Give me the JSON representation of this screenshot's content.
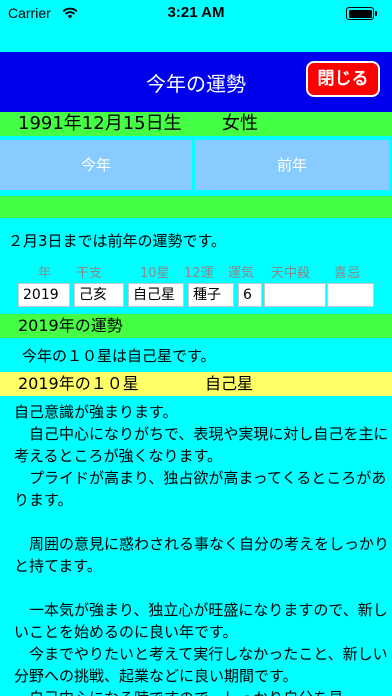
{
  "status_bar": {
    "carrier": "Carrier",
    "time": "3:21 AM"
  },
  "nav": {
    "title": "今年の運勢",
    "close_label": "閉じる"
  },
  "profile": {
    "birth_date": "1991年12月15日生",
    "gender": "女性"
  },
  "tabs": [
    {
      "label": "今年"
    },
    {
      "label": "前年"
    }
  ],
  "notice": "２月3日までは前年の運勢です。",
  "table": {
    "headers": [
      "年",
      "干支",
      "10星",
      "12運",
      "運気",
      "天中殺",
      "喜忌"
    ],
    "values": [
      "2019",
      "己亥",
      "自己星",
      "種子",
      "6",
      "",
      ""
    ]
  },
  "fortune_section": {
    "title": "2019年の運勢",
    "summary": "今年の１０星は自己星です。"
  },
  "star_section": {
    "title": "2019年の１０星",
    "star": "自己星"
  },
  "body_text": "自己意識が強まります。\n　自己中心になりがちで、表現や実現に対し自己を主に考えるところが強くなります。\n　プライドが高まり、独占欲が高まってくるところがあります。\n\n　周囲の意見に惑わされる事なく自分の考えをしっかりと持てます。\n\n　一本気が強まり、独立心が旺盛になりますので、新しいことを始めるのに良い年です。\n　今までやりたいと考えて実行しなかったこと、新しい分野への挑戦、起業などに良い期間です。\n　自己中心になる時ですので、しっかり自分を見"
}
